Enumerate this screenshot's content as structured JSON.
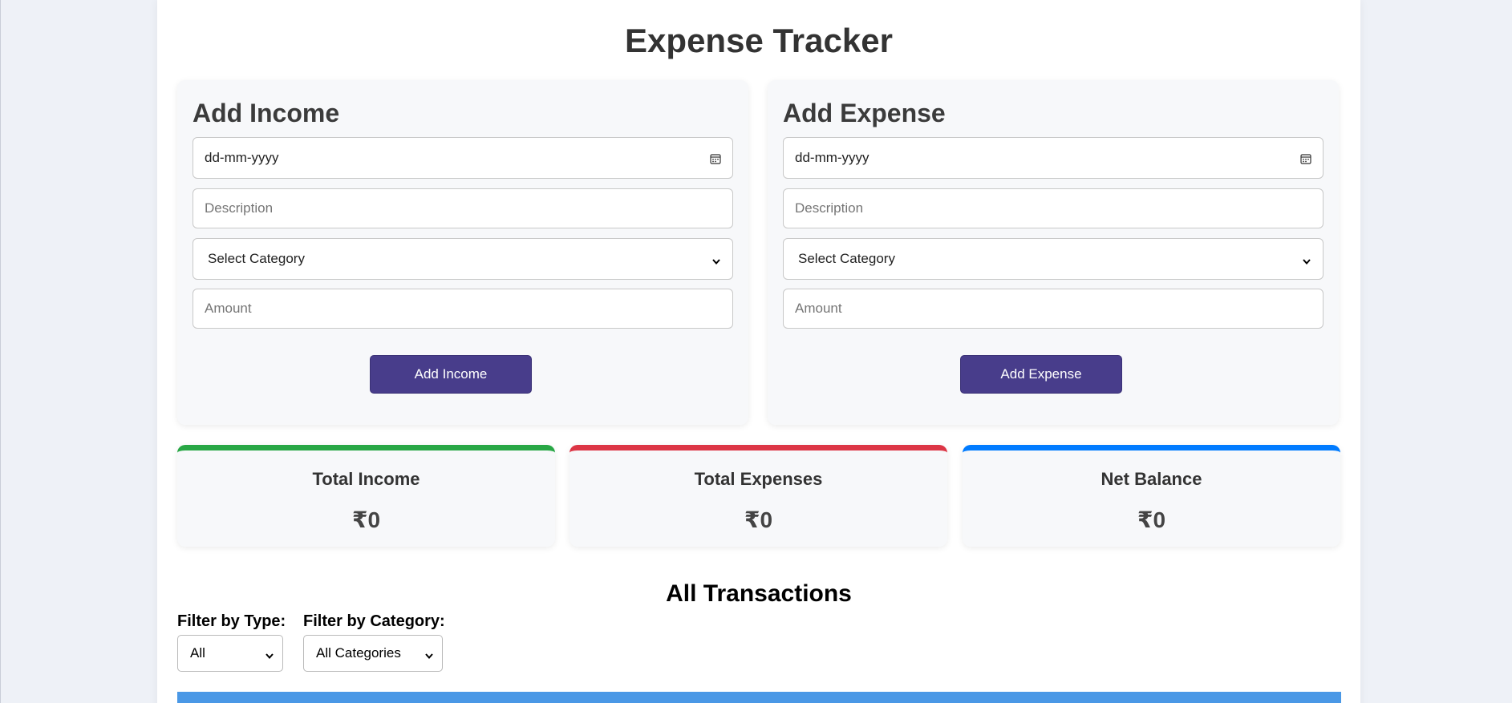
{
  "app": {
    "title": "Expense Tracker"
  },
  "income_form": {
    "title": "Add Income",
    "date_placeholder": "dd-mm-yyyy",
    "description_placeholder": "Description",
    "category_selected": "Select Category",
    "amount_placeholder": "Amount",
    "submit_label": "Add Income"
  },
  "expense_form": {
    "title": "Add Expense",
    "date_placeholder": "dd-mm-yyyy",
    "description_placeholder": "Description",
    "category_selected": "Select Category",
    "amount_placeholder": "Amount",
    "submit_label": "Add Expense"
  },
  "summary": {
    "income": {
      "label": "Total Income",
      "value": "₹0",
      "accent": "#28a745"
    },
    "expenses": {
      "label": "Total Expenses",
      "value": "₹0",
      "accent": "#dc3545"
    },
    "balance": {
      "label": "Net Balance",
      "value": "₹0",
      "accent": "#007bff"
    }
  },
  "transactions": {
    "title": "All Transactions",
    "filter_type": {
      "label": "Filter by Type:",
      "selected": "All"
    },
    "filter_category": {
      "label": "Filter by Category:",
      "selected": "All Categories"
    },
    "header_color": "#4a98e6"
  },
  "colors": {
    "primary_button": "#483d8b",
    "page_bg": "#eef1f7"
  },
  "icons": {
    "date": "calendar-icon",
    "dropdown": "chevron-down-icon"
  }
}
